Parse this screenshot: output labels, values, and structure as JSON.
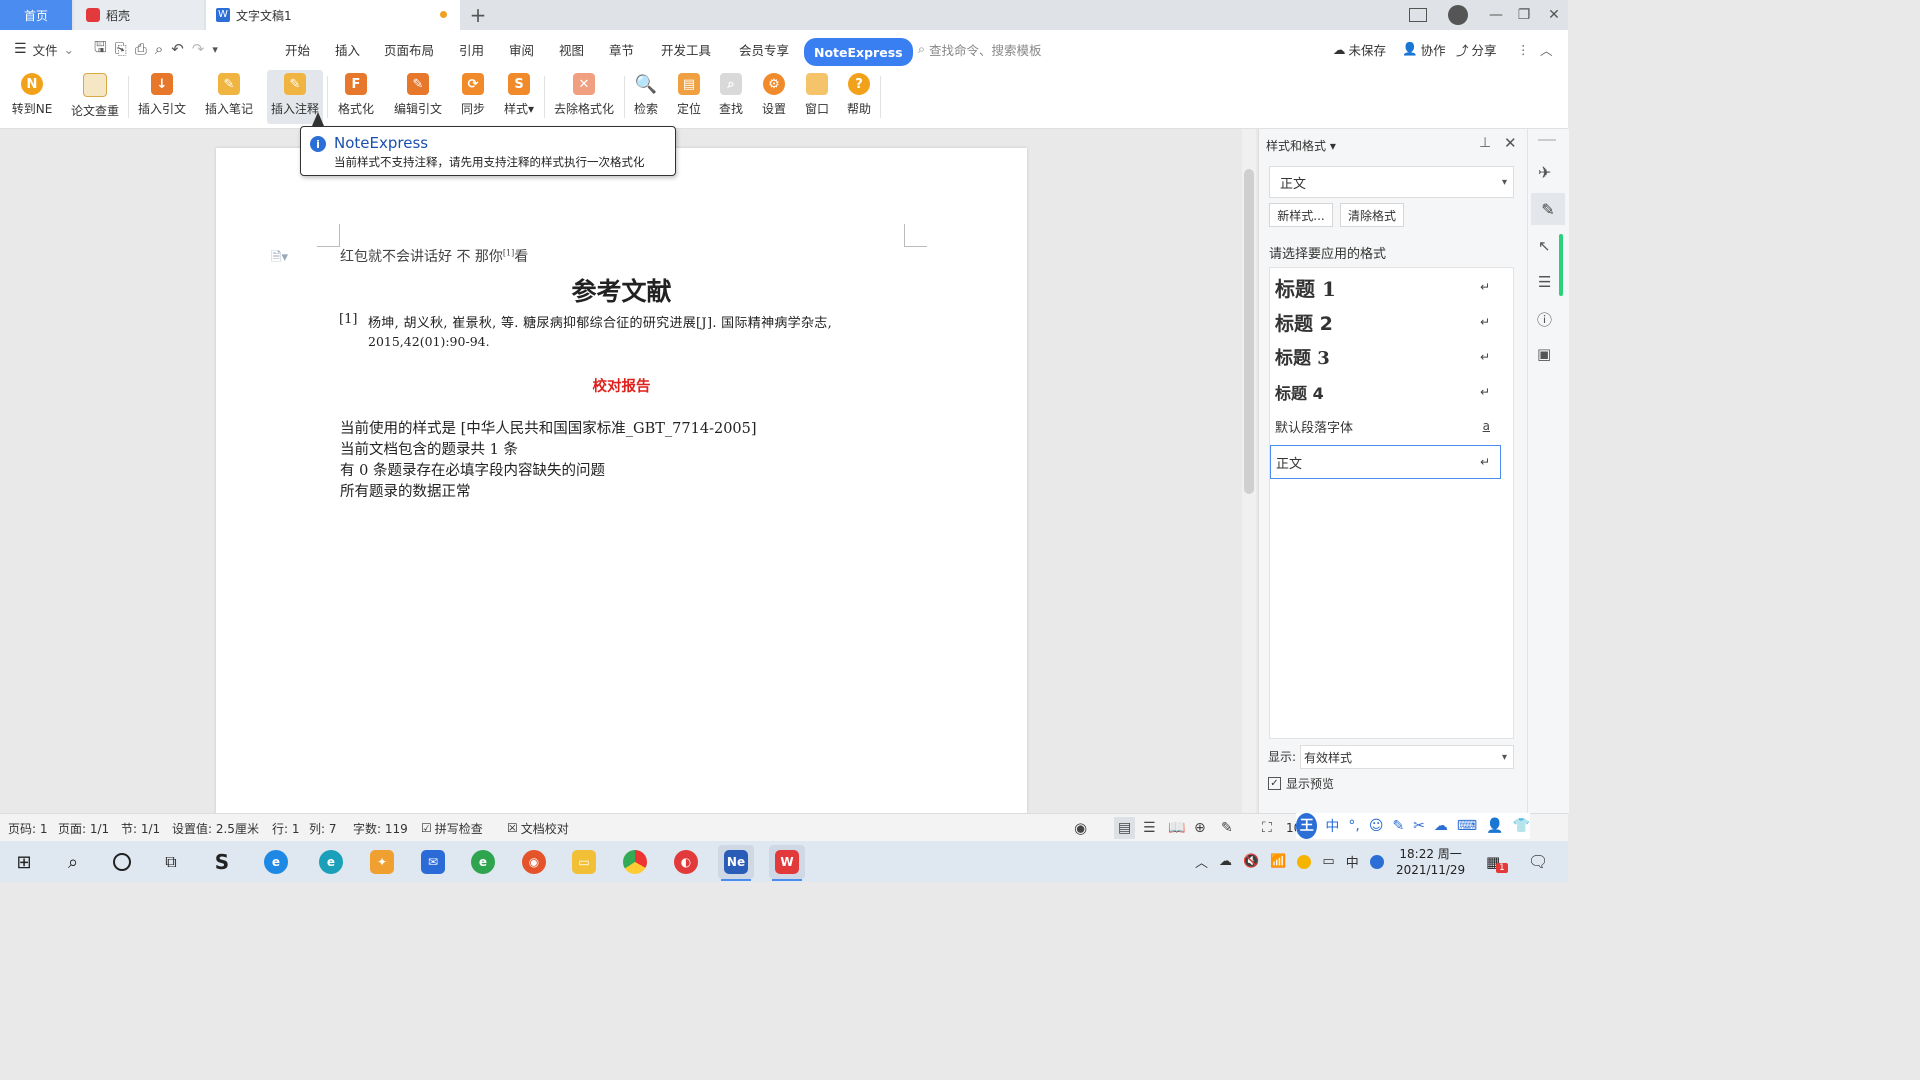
{
  "titlebar": {
    "tabs": [
      {
        "label": "首页"
      },
      {
        "label": "稻壳"
      },
      {
        "label": "文字文稿1"
      }
    ]
  },
  "menubar": {
    "file": "文件",
    "items": [
      "开始",
      "插入",
      "页面布局",
      "引用",
      "审阅",
      "视图",
      "章节",
      "开发工具",
      "会员专享"
    ],
    "noteexpress": "NoteExpress",
    "search_placeholder": "查找命令、搜索模板",
    "unsaved": "未保存",
    "collab": "协作",
    "share": "分享"
  },
  "ribbon": {
    "buttons": [
      {
        "label": "转到NE"
      },
      {
        "label": "论文查重"
      },
      {
        "label": "插入引文"
      },
      {
        "label": "插入笔记"
      },
      {
        "label": "插入注释"
      },
      {
        "label": "格式化"
      },
      {
        "label": "编辑引文"
      },
      {
        "label": "同步"
      },
      {
        "label": "样式"
      },
      {
        "label": "去除格式化"
      },
      {
        "label": "检索"
      },
      {
        "label": "定位"
      },
      {
        "label": "查找"
      },
      {
        "label": "设置"
      },
      {
        "label": "窗口"
      },
      {
        "label": "帮助"
      }
    ]
  },
  "tooltip": {
    "title": "NoteExpress",
    "message": "当前样式不支持注释，请先用支持注释的样式执行一次格式化"
  },
  "document": {
    "line1": "红包就不会讲话好    不  那你",
    "cite_mark": "[1]",
    "line1_end": "看",
    "ref_heading": "参考文献",
    "ref_num": "[1]",
    "ref_text_1": "杨坤, 胡义秋, 崔景秋, 等. 糖尿病抑郁综合征的研究进展[J]. 国际精神病学杂志,",
    "ref_text_2": "2015,42(01):90-94.",
    "report_title": "校对报告",
    "report_lines": [
      "当前使用的样式是  [中华人民共和国国家标准_GBT_7714-2005]",
      "当前文档包含的题录共 1 条",
      "有 0 条题录存在必填字段内容缺失的问题",
      "所有题录的数据正常"
    ]
  },
  "panel": {
    "title": "样式和格式",
    "current_style": "正文",
    "new_style": "新样式...",
    "clear_format": "清除格式",
    "prompt": "请选择要应用的格式",
    "styles": [
      {
        "label": "标题  1"
      },
      {
        "label": "标题  2"
      },
      {
        "label": "标题  3"
      },
      {
        "label": "标题  4"
      },
      {
        "label": "默认段落字体"
      },
      {
        "label": "正文"
      }
    ],
    "show_label": "显示:",
    "show_value": "有效样式",
    "preview_label": "显示预览"
  },
  "statusbar": {
    "page_code": "页码: 1",
    "page": "页面: 1/1",
    "section": "节: 1/1",
    "setting": "设置值: 2.5厘米",
    "row": "行: 1",
    "col": "列: 7",
    "words": "字数: 119",
    "spell": "拼写检查",
    "proof": "文档校对",
    "zoom": "10"
  },
  "taskbar": {
    "time": "18:22 周一",
    "date": "2021/11/29",
    "ime_cn": "中",
    "notification_count": "1"
  },
  "colors": {
    "accent": "#3a7ff2",
    "report_title": "#e0201c",
    "home_tab": "#4a8cf0"
  }
}
